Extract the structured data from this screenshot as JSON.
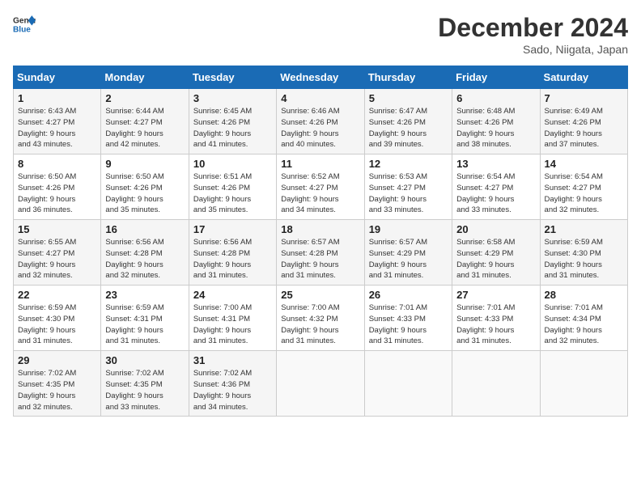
{
  "header": {
    "logo_line1": "General",
    "logo_line2": "Blue",
    "month_title": "December 2024",
    "subtitle": "Sado, Niigata, Japan"
  },
  "weekdays": [
    "Sunday",
    "Monday",
    "Tuesday",
    "Wednesday",
    "Thursday",
    "Friday",
    "Saturday"
  ],
  "weeks": [
    [
      {
        "day": "1",
        "sunrise": "6:43 AM",
        "sunset": "4:27 PM",
        "daylight": "9 hours and 43 minutes."
      },
      {
        "day": "2",
        "sunrise": "6:44 AM",
        "sunset": "4:27 PM",
        "daylight": "9 hours and 42 minutes."
      },
      {
        "day": "3",
        "sunrise": "6:45 AM",
        "sunset": "4:26 PM",
        "daylight": "9 hours and 41 minutes."
      },
      {
        "day": "4",
        "sunrise": "6:46 AM",
        "sunset": "4:26 PM",
        "daylight": "9 hours and 40 minutes."
      },
      {
        "day": "5",
        "sunrise": "6:47 AM",
        "sunset": "4:26 PM",
        "daylight": "9 hours and 39 minutes."
      },
      {
        "day": "6",
        "sunrise": "6:48 AM",
        "sunset": "4:26 PM",
        "daylight": "9 hours and 38 minutes."
      },
      {
        "day": "7",
        "sunrise": "6:49 AM",
        "sunset": "4:26 PM",
        "daylight": "9 hours and 37 minutes."
      }
    ],
    [
      {
        "day": "8",
        "sunrise": "6:50 AM",
        "sunset": "4:26 PM",
        "daylight": "9 hours and 36 minutes."
      },
      {
        "day": "9",
        "sunrise": "6:50 AM",
        "sunset": "4:26 PM",
        "daylight": "9 hours and 35 minutes."
      },
      {
        "day": "10",
        "sunrise": "6:51 AM",
        "sunset": "4:26 PM",
        "daylight": "9 hours and 35 minutes."
      },
      {
        "day": "11",
        "sunrise": "6:52 AM",
        "sunset": "4:27 PM",
        "daylight": "9 hours and 34 minutes."
      },
      {
        "day": "12",
        "sunrise": "6:53 AM",
        "sunset": "4:27 PM",
        "daylight": "9 hours and 33 minutes."
      },
      {
        "day": "13",
        "sunrise": "6:54 AM",
        "sunset": "4:27 PM",
        "daylight": "9 hours and 33 minutes."
      },
      {
        "day": "14",
        "sunrise": "6:54 AM",
        "sunset": "4:27 PM",
        "daylight": "9 hours and 32 minutes."
      }
    ],
    [
      {
        "day": "15",
        "sunrise": "6:55 AM",
        "sunset": "4:27 PM",
        "daylight": "9 hours and 32 minutes."
      },
      {
        "day": "16",
        "sunrise": "6:56 AM",
        "sunset": "4:28 PM",
        "daylight": "9 hours and 32 minutes."
      },
      {
        "day": "17",
        "sunrise": "6:56 AM",
        "sunset": "4:28 PM",
        "daylight": "9 hours and 31 minutes."
      },
      {
        "day": "18",
        "sunrise": "6:57 AM",
        "sunset": "4:28 PM",
        "daylight": "9 hours and 31 minutes."
      },
      {
        "day": "19",
        "sunrise": "6:57 AM",
        "sunset": "4:29 PM",
        "daylight": "9 hours and 31 minutes."
      },
      {
        "day": "20",
        "sunrise": "6:58 AM",
        "sunset": "4:29 PM",
        "daylight": "9 hours and 31 minutes."
      },
      {
        "day": "21",
        "sunrise": "6:59 AM",
        "sunset": "4:30 PM",
        "daylight": "9 hours and 31 minutes."
      }
    ],
    [
      {
        "day": "22",
        "sunrise": "6:59 AM",
        "sunset": "4:30 PM",
        "daylight": "9 hours and 31 minutes."
      },
      {
        "day": "23",
        "sunrise": "6:59 AM",
        "sunset": "4:31 PM",
        "daylight": "9 hours and 31 minutes."
      },
      {
        "day": "24",
        "sunrise": "7:00 AM",
        "sunset": "4:31 PM",
        "daylight": "9 hours and 31 minutes."
      },
      {
        "day": "25",
        "sunrise": "7:00 AM",
        "sunset": "4:32 PM",
        "daylight": "9 hours and 31 minutes."
      },
      {
        "day": "26",
        "sunrise": "7:01 AM",
        "sunset": "4:33 PM",
        "daylight": "9 hours and 31 minutes."
      },
      {
        "day": "27",
        "sunrise": "7:01 AM",
        "sunset": "4:33 PM",
        "daylight": "9 hours and 31 minutes."
      },
      {
        "day": "28",
        "sunrise": "7:01 AM",
        "sunset": "4:34 PM",
        "daylight": "9 hours and 32 minutes."
      }
    ],
    [
      {
        "day": "29",
        "sunrise": "7:02 AM",
        "sunset": "4:35 PM",
        "daylight": "9 hours and 32 minutes."
      },
      {
        "day": "30",
        "sunrise": "7:02 AM",
        "sunset": "4:35 PM",
        "daylight": "9 hours and 33 minutes."
      },
      {
        "day": "31",
        "sunrise": "7:02 AM",
        "sunset": "4:36 PM",
        "daylight": "9 hours and 34 minutes."
      },
      null,
      null,
      null,
      null
    ]
  ]
}
